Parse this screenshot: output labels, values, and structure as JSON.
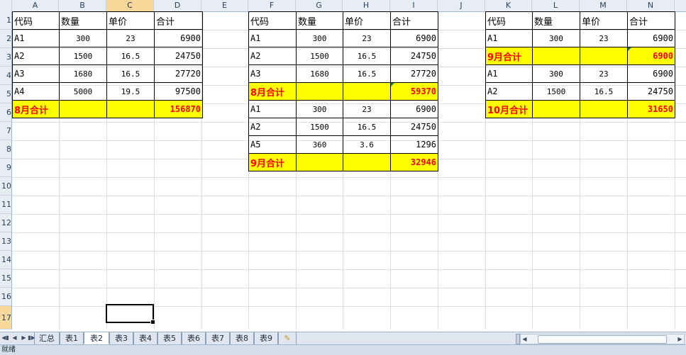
{
  "columns": [
    "A",
    "B",
    "C",
    "D",
    "E",
    "F",
    "G",
    "H",
    "I",
    "J",
    "K",
    "L",
    "M",
    "N"
  ],
  "selected_column": "C",
  "rows": [
    "1",
    "2",
    "3",
    "4",
    "5",
    "6",
    "7",
    "8",
    "9",
    "10",
    "11",
    "12",
    "13",
    "14",
    "15",
    "16",
    "17"
  ],
  "selected_row": "17",
  "table_headers": [
    "代码",
    "数量",
    "单价",
    "合计"
  ],
  "table1": {
    "rows": [
      [
        "A1",
        "300",
        "23",
        "6900"
      ],
      [
        "A2",
        "1500",
        "16.5",
        "24750"
      ],
      [
        "A3",
        "1680",
        "16.5",
        "27720"
      ],
      [
        "A4",
        "5000",
        "19.5",
        "97500"
      ]
    ],
    "total_label": "8月合计",
    "total_value": "156870"
  },
  "table2": {
    "block1": {
      "rows": [
        [
          "A1",
          "300",
          "23",
          "6900"
        ],
        [
          "A2",
          "1500",
          "16.5",
          "24750"
        ],
        [
          "A3",
          "1680",
          "16.5",
          "27720"
        ]
      ],
      "total_label": "8月合计",
      "total_value": "59370"
    },
    "block2": {
      "rows": [
        [
          "A1",
          "300",
          "23",
          "6900"
        ],
        [
          "A2",
          "1500",
          "16.5",
          "24750"
        ],
        [
          "A5",
          "360",
          "3.6",
          "1296"
        ]
      ],
      "total_label": "9月合计",
      "total_value": "32946"
    }
  },
  "table3": {
    "block1": {
      "rows": [
        [
          "A1",
          "300",
          "23",
          "6900"
        ]
      ],
      "total_label": "9月合计",
      "total_value": "6900"
    },
    "block2": {
      "rows": [
        [
          "A1",
          "300",
          "23",
          "6900"
        ],
        [
          "A2",
          "1500",
          "16.5",
          "24750"
        ]
      ],
      "total_label": "10月合计",
      "total_value": "31650"
    }
  },
  "sheet_tabs": [
    "汇总",
    "表1",
    "表2",
    "表3",
    "表4",
    "表5",
    "表6",
    "表7",
    "表8",
    "表9"
  ],
  "active_tab": "表2",
  "status_text": "就绪",
  "colors": {
    "total_fill": "#ffff00",
    "total_text": "#ff0000",
    "header_selected": "#f9d99b"
  }
}
